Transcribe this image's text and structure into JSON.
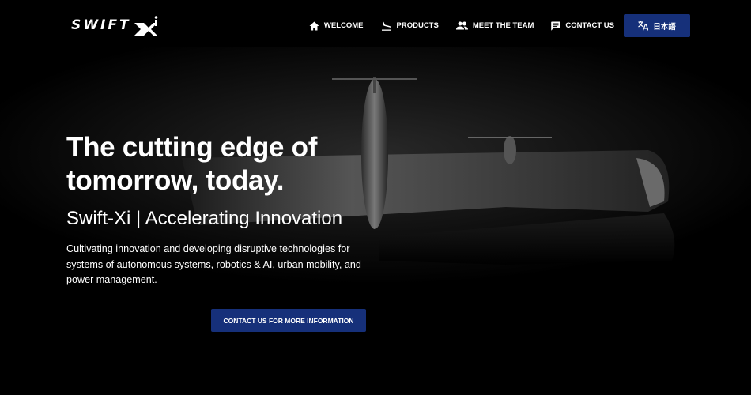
{
  "brand": {
    "logo_text": "SWIFT",
    "logo_mark": "Xi",
    "accent_color": "#16307a"
  },
  "nav": {
    "items": [
      {
        "label": "WELCOME",
        "icon": "home-icon"
      },
      {
        "label": "PRODUCTS",
        "icon": "flight-land-icon"
      },
      {
        "label": "MEET THE TEAM",
        "icon": "people-icon"
      },
      {
        "label": "CONTACT US",
        "icon": "chat-icon"
      }
    ],
    "language_button": {
      "label": "日本語",
      "icon": "translate-icon"
    }
  },
  "hero": {
    "headline": "The cutting edge of tomorrow, today.",
    "subheading": "Swift-Xi | Accelerating Innovation",
    "description": "Cultivating innovation and developing disruptive technologies for systems of autonomous systems, robotics & AI, urban mobility, and power management.",
    "cta_label": "CONTACT US FOR MORE INFORMATION"
  }
}
